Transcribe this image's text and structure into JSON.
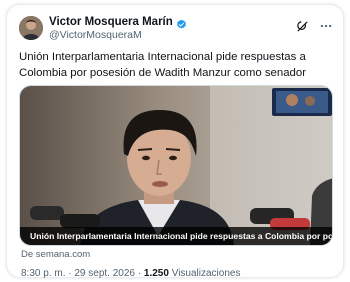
{
  "author": {
    "name": "Victor Mosquera Marín",
    "handle": "@VictorMosqueraM",
    "verified": true,
    "avatar_icon": "profile-photo"
  },
  "actions": {
    "grok_icon": "grok-icon",
    "more_icon": "more-dots-icon"
  },
  "tweet": {
    "text": "Unión Interparlamentaria Internacional pide respuestas a Colombia por posesión de Wadith Manzur como senador"
  },
  "link_card": {
    "caption": "Unión Interparlamentaria Internacional pide respuestas a Colombia por posesión de W...",
    "source": "De semana.com"
  },
  "meta": {
    "time": "8:30 p. m.",
    "separator": "·",
    "date": "29 sept. 2026",
    "views_count": "1.250",
    "views_label": "Visualizaciones"
  },
  "colors": {
    "text_primary": "#0f1419",
    "text_secondary": "#536471",
    "verified_blue": "#1d9bf0",
    "border": "#cfd9de"
  }
}
